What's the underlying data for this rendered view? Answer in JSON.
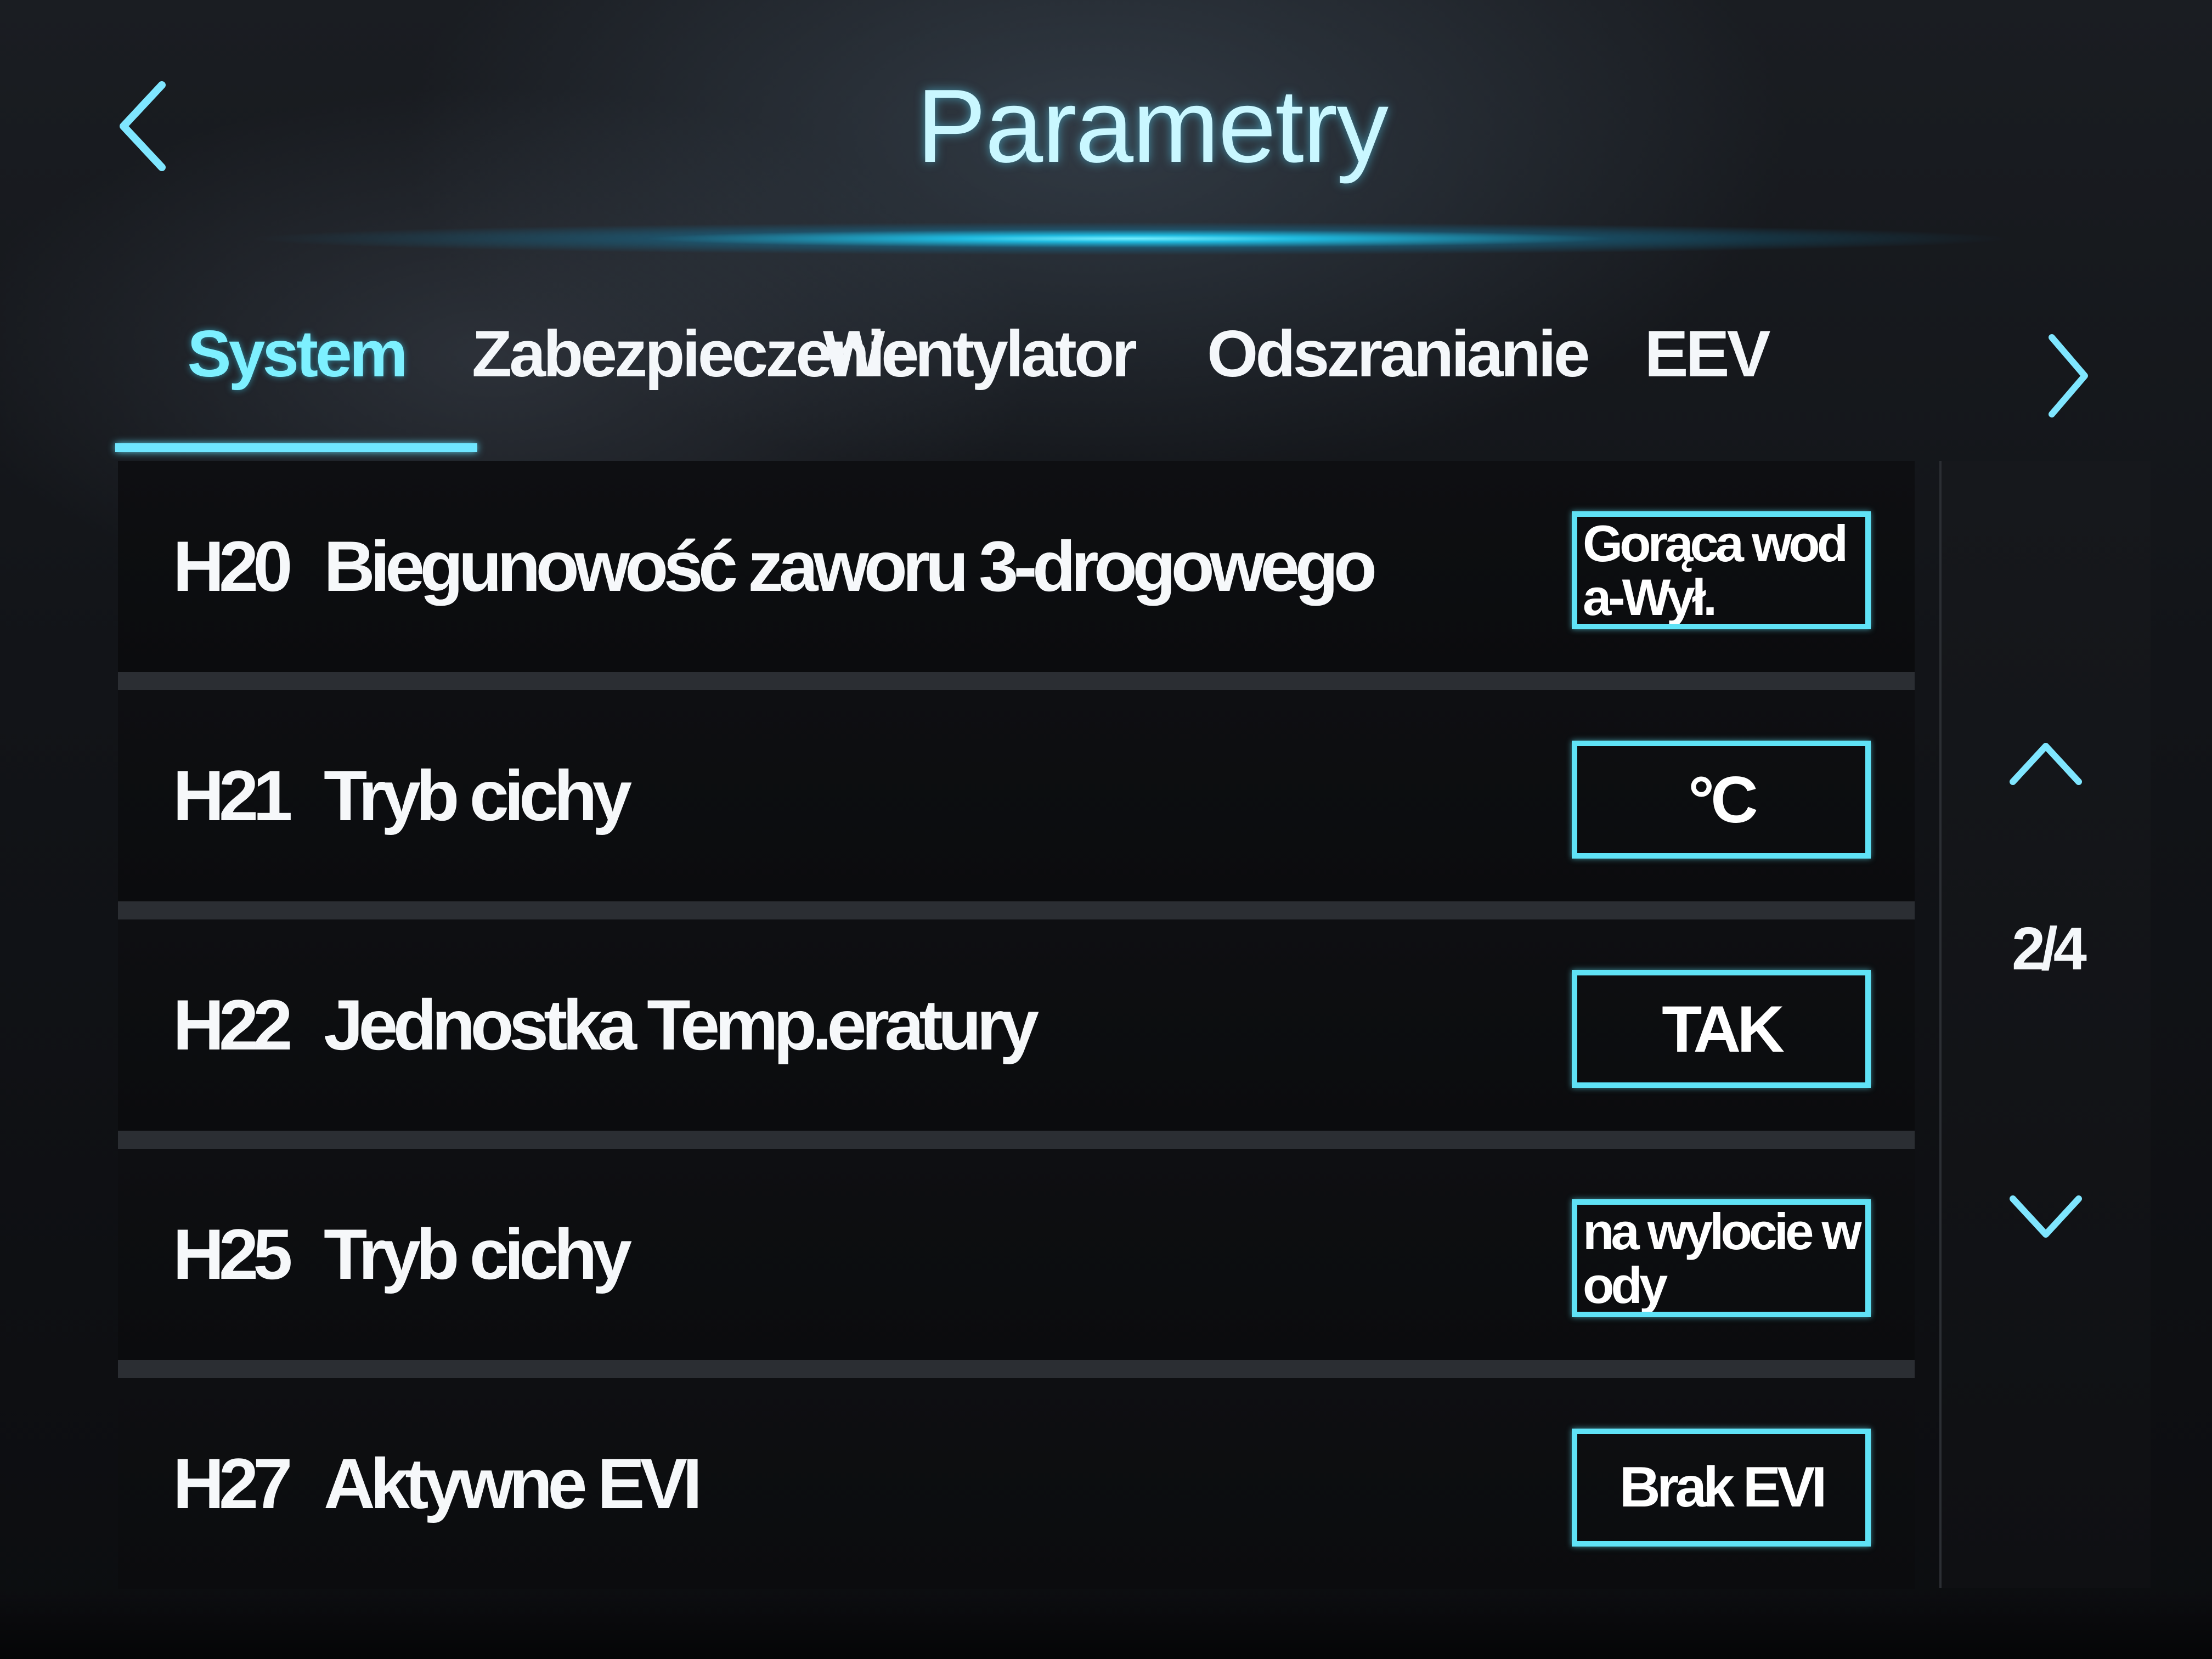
{
  "header": {
    "title": "Parametry",
    "back_icon": "chevron-left-icon"
  },
  "tabs": {
    "items": [
      {
        "label": "System",
        "active": true
      },
      {
        "label": "Zabezpieczenie",
        "active": false
      },
      {
        "label": "Wentylator",
        "active": false
      },
      {
        "label": "Odszranianie",
        "active": false
      },
      {
        "label": "EEV",
        "active": false
      }
    ],
    "next_icon": "chevron-right-icon"
  },
  "parameters": {
    "rows": [
      {
        "code": "H20",
        "name": "Biegunowość zaworu 3-drogowego",
        "value": "Gorąca woda-Wył."
      },
      {
        "code": "H21",
        "name": "Tryb cichy",
        "value": "°C"
      },
      {
        "code": "H22",
        "name": "Jednostka Temp.eratury",
        "value": "TAK"
      },
      {
        "code": "H25",
        "name": "Tryb cichy",
        "value": "na wylocie wody"
      },
      {
        "code": "H27",
        "name": "Aktywne EVI",
        "value": "Brak EVI"
      }
    ]
  },
  "pager": {
    "label": "2/4",
    "up_icon": "chevron-up-icon",
    "down_icon": "chevron-down-icon"
  },
  "colors": {
    "accent": "#6fe6ff",
    "title": "#c9f7ff",
    "background": "#0c0d10",
    "row_background": "#0e0f12",
    "separator": "#2b2e33"
  }
}
